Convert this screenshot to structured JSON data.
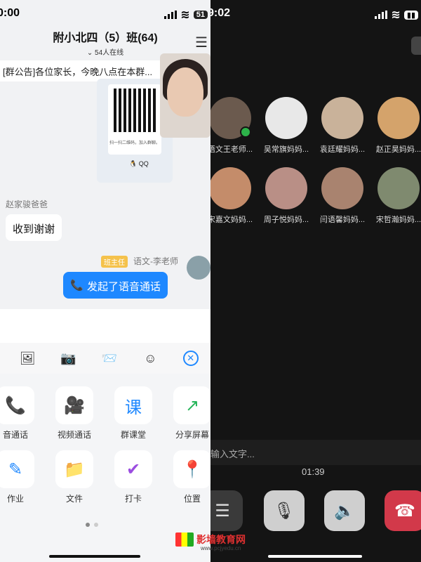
{
  "left": {
    "status": {
      "time": "0:00",
      "battery": "51"
    },
    "header": {
      "title": "附小北四（5）班(64)",
      "subtitle": "⌄ 54人在线"
    },
    "notice": "[群公告]各位家长，今晚八点在本群...",
    "qr_card": {
      "caption": "扫一扫二维码，加入群聊。",
      "qq_label": "QQ"
    },
    "messages": [
      {
        "sender": "赵家骏爸爸",
        "text": "收到谢谢"
      },
      {
        "badge": "班主任",
        "sender": "语文-李老师",
        "text": "发起了语音通话"
      }
    ],
    "toolbar": [
      "photo-icon",
      "camera-icon",
      "file-icon",
      "emoji-icon",
      "close-icon"
    ],
    "apps": [
      {
        "label": "音通话",
        "icon": "phone-icon",
        "color": "#1e88ff"
      },
      {
        "label": "视频通话",
        "icon": "video-icon",
        "color": "#1e88ff"
      },
      {
        "label": "群课堂",
        "icon": "classroom-icon",
        "color": "#1e88ff"
      },
      {
        "label": "分享屏幕",
        "icon": "share-screen-icon",
        "color": "#26b55a"
      },
      {
        "label": "作业",
        "icon": "homework-icon",
        "color": "#1e88ff"
      },
      {
        "label": "文件",
        "icon": "folder-icon",
        "color": "#f5a623"
      },
      {
        "label": "打卡",
        "icon": "checkin-icon",
        "color": "#9b4de0"
      },
      {
        "label": "位置",
        "icon": "location-icon",
        "color": "#1e88ff"
      }
    ],
    "watermark": "影墙教育网",
    "watermark_url": "www.pcjyedu.cn"
  },
  "right": {
    "status": {
      "time": "9:02"
    },
    "participants": [
      {
        "name": "语文王老师...",
        "color": "#6b5a4e",
        "mic": true
      },
      {
        "name": "吴常旗妈妈...",
        "color": "#e8e8e8",
        "mic": false
      },
      {
        "name": "袁廷耀妈妈...",
        "color": "#c9b29a",
        "mic": false
      },
      {
        "name": "赵正昊妈妈...",
        "color": "#d4a36b",
        "mic": false
      },
      {
        "name": "宋嘉文妈妈...",
        "color": "#c48c6a",
        "mic": false
      },
      {
        "name": "周子悦妈妈...",
        "color": "#b98f86",
        "mic": false
      },
      {
        "name": "闫语馨妈妈...",
        "color": "#a9836f",
        "mic": false
      },
      {
        "name": "宋哲瀚妈妈...",
        "color": "#7f8a6f",
        "mic": false
      }
    ],
    "input_placeholder": "输入文字...",
    "timer": "01:39"
  }
}
